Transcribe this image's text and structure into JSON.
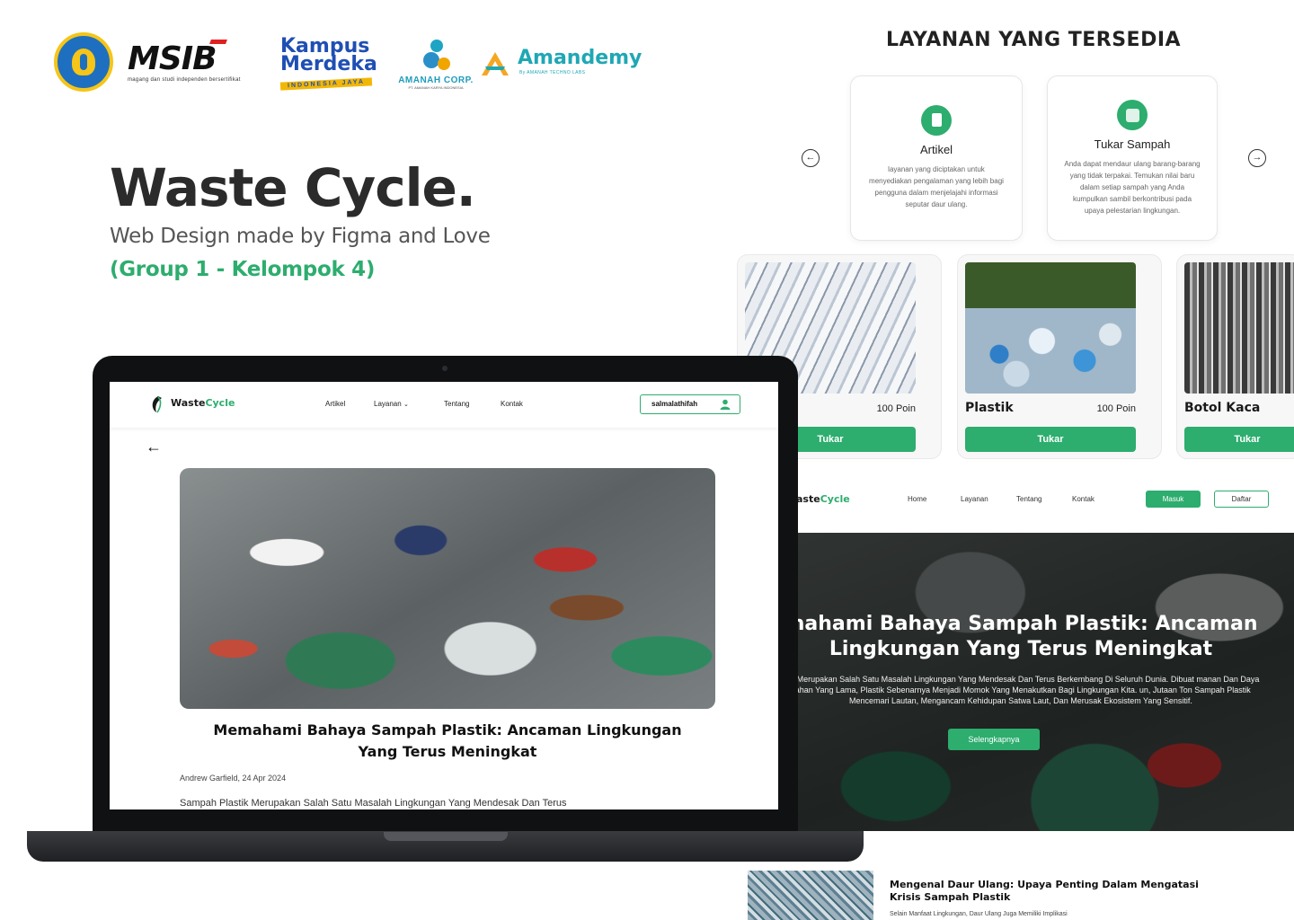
{
  "logos": {
    "msib_word": "MSIB",
    "msib_tagline": "magang dan studi independen bersertifikat",
    "kampus_line1": "Kampus",
    "kampus_line2": "Merdeka",
    "kampus_band": "INDONESIA JAYA",
    "amanah_name": "AMANAH CORP.",
    "amanah_sub": "PT. AMANAH KARYA INDONESIA",
    "amandemy_name": "Amandemy",
    "amandemy_sub": "By AMANAH TECHNO LABS"
  },
  "hero": {
    "title": "Waste Cycle.",
    "subtitle": "Web Design made by Figma and Love",
    "group": "(Group 1 - Kelompok 4)"
  },
  "layanan": {
    "title": "LAYANAN YANG TERSEDIA",
    "prev_icon": "arrow-left-circle-icon",
    "next_icon": "arrow-right-circle-icon",
    "cards": [
      {
        "icon": "document-icon",
        "name": "Artikel",
        "desc": "layanan yang diciptakan untuk menyediakan pengalaman yang lebih bagi pengguna dalam menjelajahi informasi seputar daur ulang."
      },
      {
        "icon": "recycle-bag-icon",
        "name": "Tukar Sampah",
        "desc": "Anda dapat mendaur ulang barang-barang yang tidak terpakai. Temukan nilai baru dalam setiap sampah yang Anda kumpulkan sambil berkontribusi pada upaya pelestarian lingkungan."
      }
    ]
  },
  "products": [
    {
      "name": "",
      "poin": "100 Poin",
      "button": "Tukar",
      "image": "newspaper-photo"
    },
    {
      "name": "Plastik",
      "poin": "100 Poin",
      "button": "Tukar",
      "image": "plastic-bottles-photo"
    },
    {
      "name": "Botol Kaca",
      "poin": "",
      "button": "Tukar",
      "image": "glass-bottles-photo"
    }
  ],
  "landing": {
    "logo_a": "aste",
    "logo_b": "Cycle",
    "nav": [
      "Home",
      "Layanan",
      "Tentang",
      "Kontak"
    ],
    "masuk": "Masuk",
    "daftar": "Daftar",
    "title": "mahami Bahaya Sampah Plastik: Ancaman\nLingkungan Yang Terus Meningkat",
    "para": "stik Merupakan Salah Satu Masalah Lingkungan Yang Mendesak Dan Terus Berkembang Di Seluruh Dunia. Dibuat manan Dan Daya Tahan Yang Lama, Plastik Sebenarnya Menjadi Momok Yang Menakutkan Bagi Lingkungan Kita. un, Jutaan Ton Sampah Plastik Mencemari Lautan, Mengancam Kehidupan Satwa Laut, Dan Merusak Ekosistem Yang Sensitif.",
    "button": "Selengkapnya"
  },
  "teaser": {
    "title": "Mengenal Daur Ulang: Upaya Penting Dalam Mengatasi Krisis Sampah Plastik",
    "sub": "Selain Manfaat Lingkungan, Daur Ulang Juga Memiliki Implikasi"
  },
  "laptop": {
    "logo_a": "Waste",
    "logo_b": "Cycle",
    "nav": [
      "Artikel",
      "Layanan",
      "Tentang",
      "Kontak"
    ],
    "user": "salmalathifah",
    "back_icon": "arrow-left-icon",
    "article_title": "Memahami Bahaya Sampah Plastik: Ancaman Lingkungan\nYang Terus Meningkat",
    "meta": "Andrew Garfield, 24 Apr 2024",
    "body": "Sampah Plastik Merupakan Salah Satu Masalah Lingkungan Yang Mendesak Dan Terus"
  },
  "colors": {
    "accent": "#2dad6e",
    "laptop_body": "#101113"
  }
}
